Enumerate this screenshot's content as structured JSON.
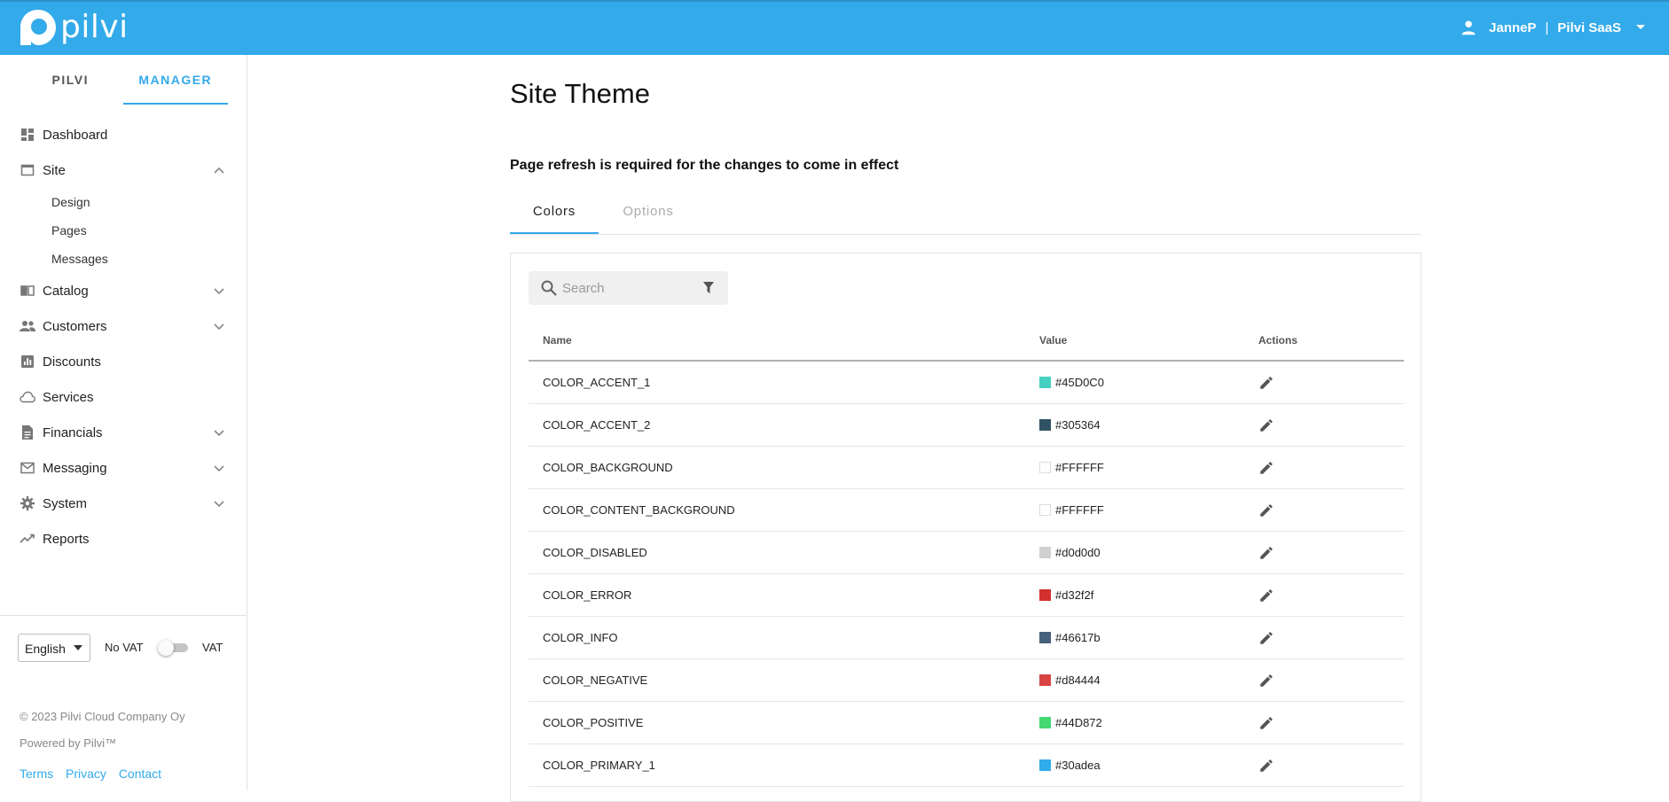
{
  "header": {
    "logo_text": "pilvi",
    "user_name": "JanneP",
    "separator": "|",
    "organization": "Pilvi SaaS"
  },
  "sidebar": {
    "tabs": [
      {
        "label": "PILVI",
        "active": false
      },
      {
        "label": "MANAGER",
        "active": true
      }
    ],
    "nav": [
      {
        "label": "Dashboard",
        "icon": "dashboard-icon"
      },
      {
        "label": "Site",
        "icon": "window-icon",
        "expanded": true,
        "children": [
          "Design",
          "Pages",
          "Messages"
        ]
      },
      {
        "label": "Catalog",
        "icon": "book-icon",
        "expandable": true
      },
      {
        "label": "Customers",
        "icon": "people-icon",
        "expandable": true
      },
      {
        "label": "Discounts",
        "icon": "chart-box-icon"
      },
      {
        "label": "Services",
        "icon": "cloud-icon"
      },
      {
        "label": "Financials",
        "icon": "document-icon",
        "expandable": true
      },
      {
        "label": "Messaging",
        "icon": "mail-icon",
        "expandable": true
      },
      {
        "label": "System",
        "icon": "gear-icon",
        "expandable": true
      },
      {
        "label": "Reports",
        "icon": "trending-up-icon"
      }
    ],
    "language": "English",
    "vat_off_label": "No VAT",
    "vat_on_label": "VAT",
    "vat_enabled": false,
    "copyright": "© 2023 Pilvi Cloud Company Oy",
    "powered_by": "Powered by Pilvi™",
    "links": [
      "Terms",
      "Privacy",
      "Contact"
    ]
  },
  "main": {
    "title": "Site Theme",
    "notice": "Page refresh is required for the changes to come in effect",
    "tabs": [
      {
        "label": "Colors",
        "active": true
      },
      {
        "label": "Options",
        "active": false
      }
    ],
    "search_placeholder": "Search",
    "table": {
      "columns": [
        "Name",
        "Value",
        "Actions"
      ],
      "rows": [
        {
          "name": "COLOR_ACCENT_1",
          "value": "#45D0C0",
          "color": "#45D0C0"
        },
        {
          "name": "COLOR_ACCENT_2",
          "value": "#305364",
          "color": "#305364"
        },
        {
          "name": "COLOR_BACKGROUND",
          "value": "#FFFFFF",
          "color": "#FFFFFF"
        },
        {
          "name": "COLOR_CONTENT_BACKGROUND",
          "value": "#FFFFFF",
          "color": "#FFFFFF"
        },
        {
          "name": "COLOR_DISABLED",
          "value": "#d0d0d0",
          "color": "#d0d0d0"
        },
        {
          "name": "COLOR_ERROR",
          "value": "#d32f2f",
          "color": "#d32f2f"
        },
        {
          "name": "COLOR_INFO",
          "value": "#46617b",
          "color": "#46617b"
        },
        {
          "name": "COLOR_NEGATIVE",
          "value": "#d84444",
          "color": "#d84444"
        },
        {
          "name": "COLOR_POSITIVE",
          "value": "#44D872",
          "color": "#44D872"
        },
        {
          "name": "COLOR_PRIMARY_1",
          "value": "#30adea",
          "color": "#30adea"
        }
      ]
    }
  },
  "colors": {
    "brand": "#33aaea",
    "accent_underline": "#33aaea"
  }
}
